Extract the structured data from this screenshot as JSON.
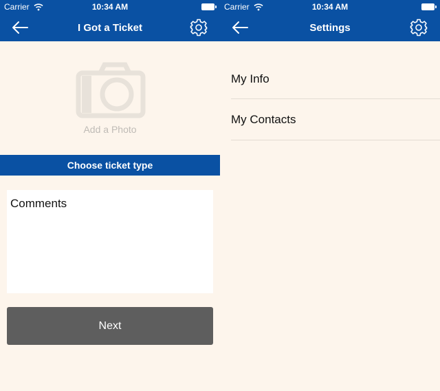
{
  "colors": {
    "brand_blue": "#0a51a3",
    "background": "#fdf5ec",
    "next_button": "#5e5e5e",
    "placeholder_gray": "#bfbbb6"
  },
  "left": {
    "status": {
      "carrier": "Carrier",
      "time": "10:34 AM"
    },
    "nav": {
      "title": "I Got a Ticket",
      "back_icon": "back-arrow-icon",
      "settings_icon": "gear-icon"
    },
    "photo": {
      "label": "Add a Photo",
      "icon": "camera-icon"
    },
    "ticket_type_label": "Choose ticket type",
    "comments_placeholder": "Comments",
    "next_label": "Next"
  },
  "right": {
    "status": {
      "carrier": "Carrier",
      "time": "10:34 AM"
    },
    "nav": {
      "title": "Settings",
      "back_icon": "back-arrow-icon",
      "settings_icon": "gear-icon"
    },
    "items": [
      {
        "label": "My Info"
      },
      {
        "label": "My Contacts"
      }
    ]
  }
}
